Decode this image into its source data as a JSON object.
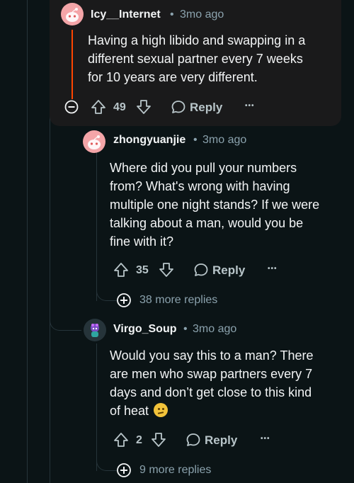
{
  "comments": [
    {
      "username": "Icy__Internet",
      "time": "3mo ago",
      "lines": [
        "Having a high libido and swapping in a",
        "different sexual partner every 7 weeks",
        "for 10 years are very different."
      ],
      "votes": "49",
      "reply_label": "Reply",
      "more": "•••"
    },
    {
      "username": "zhongyuanjie",
      "time": "3mo ago",
      "lines": [
        "Where did you pull your numbers",
        "from? What's wrong with having",
        "multiple one night stands? If we were",
        "talking about a man, would you be",
        "fine with it?"
      ],
      "votes": "35",
      "reply_label": "Reply",
      "more": "•••",
      "more_replies": "38 more replies"
    },
    {
      "username": "Virgo_Soup",
      "time": "3mo ago",
      "lines": [
        "Would you say this to a man? There",
        "are men who swap partners every 7",
        "days and don’t get close to this kind",
        "of heat"
      ],
      "votes": "2",
      "reply_label": "Reply",
      "more": "•••",
      "more_replies": "9 more replies"
    }
  ],
  "separator": "•",
  "colors": {
    "background": "#0b1416",
    "thread_line": "#26343a",
    "highlight_line": "#ff4500",
    "avatar_pink": "#f4a5a8"
  }
}
